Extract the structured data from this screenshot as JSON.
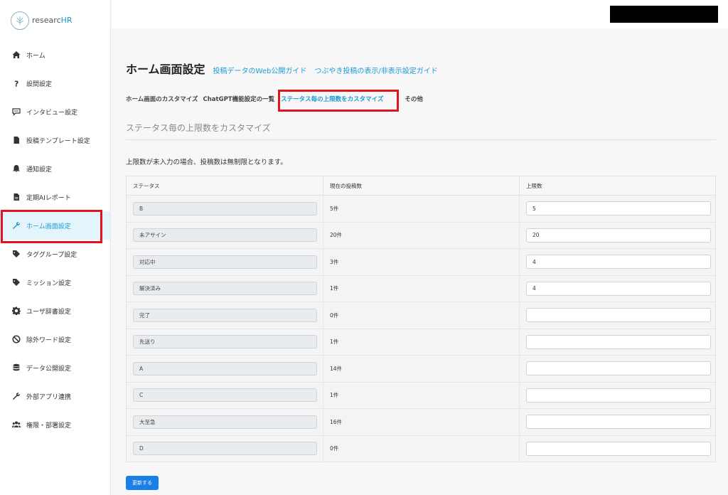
{
  "brand": {
    "prefix": "researc",
    "suffix": "HR"
  },
  "sidebar": {
    "items": [
      {
        "label": "ホーム",
        "icon": "home-icon"
      },
      {
        "label": "設問設定",
        "icon": "question-icon"
      },
      {
        "label": "インタビュー設定",
        "icon": "chat-icon"
      },
      {
        "label": "投稿テンプレート設定",
        "icon": "file-icon"
      },
      {
        "label": "通知設定",
        "icon": "bell-icon"
      },
      {
        "label": "定期AIレポート",
        "icon": "report-icon"
      },
      {
        "label": "ホーム画面設定",
        "icon": "wrench-icon",
        "active": true
      },
      {
        "label": "タググループ設定",
        "icon": "tag-icon"
      },
      {
        "label": "ミッション設定",
        "icon": "tag-icon"
      },
      {
        "label": "ユーザ辞書設定",
        "icon": "gear-icon"
      },
      {
        "label": "除外ワード設定",
        "icon": "ban-icon"
      },
      {
        "label": "データ公開設定",
        "icon": "database-icon"
      },
      {
        "label": "外部アプリ連携",
        "icon": "wrench-icon"
      },
      {
        "label": "権限・部署設定",
        "icon": "users-icon"
      }
    ]
  },
  "header": {
    "title": "ホーム画面設定",
    "guide_links": [
      "投稿データのWeb公開ガイド",
      "つぶやき投稿の表示/非表示設定ガイド"
    ]
  },
  "tabs": [
    {
      "label": "ホーム画面のカスタマイズ"
    },
    {
      "label": "ChatGPT機能設定の一覧"
    },
    {
      "label": "ステータス毎の上限数をカスタマイズ",
      "active": true
    },
    {
      "label": "その他"
    }
  ],
  "section": {
    "title": "ステータス毎の上限数をカスタマイズ",
    "note": "上限数が未入力の場合、投稿数は無制限となります。"
  },
  "table": {
    "headers": [
      "ステータス",
      "現在の投稿数",
      "上限数"
    ],
    "rows": [
      {
        "status": "B",
        "count": "5件",
        "limit": "5"
      },
      {
        "status": "未アサイン",
        "count": "20件",
        "limit": "20"
      },
      {
        "status": "対応中",
        "count": "3件",
        "limit": "4"
      },
      {
        "status": "解決済み",
        "count": "1件",
        "limit": "4"
      },
      {
        "status": "完了",
        "count": "0件",
        "limit": ""
      },
      {
        "status": "先送り",
        "count": "1件",
        "limit": ""
      },
      {
        "status": "A",
        "count": "14件",
        "limit": ""
      },
      {
        "status": "C",
        "count": "1件",
        "limit": ""
      },
      {
        "status": "大至急",
        "count": "16件",
        "limit": ""
      },
      {
        "status": "D",
        "count": "0件",
        "limit": ""
      }
    ]
  },
  "actions": {
    "update_label": "更新する"
  },
  "colors": {
    "accent": "#1a9bd7",
    "highlight": "#e0131f",
    "button": "#1a7fe6"
  }
}
